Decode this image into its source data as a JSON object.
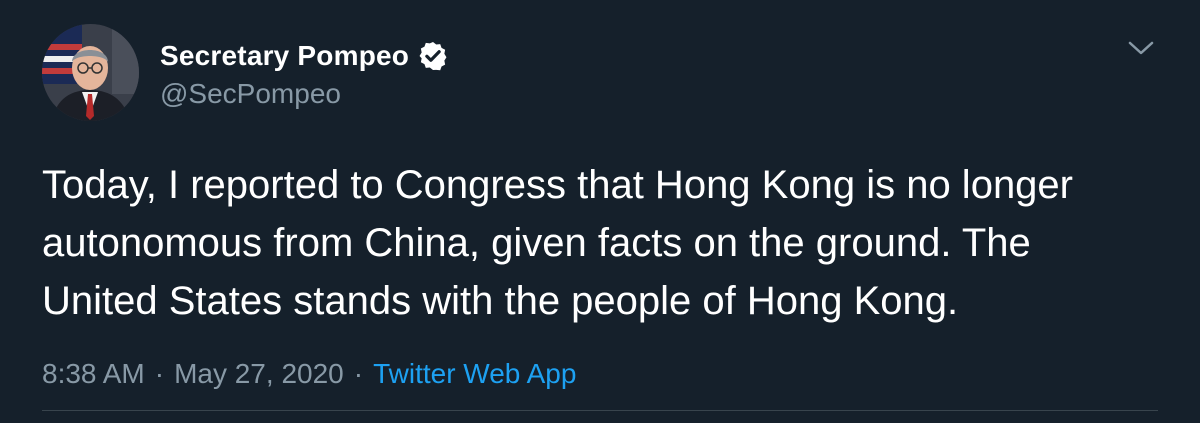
{
  "author": {
    "display_name": "Secretary Pompeo",
    "handle": "@SecPompeo",
    "verified": true
  },
  "tweet": {
    "text": "Today, I reported to Congress that Hong Kong is no longer\nautonomous from China, given facts on the ground. The\nUnited States stands with the people of Hong Kong.",
    "time": "8:38 AM",
    "separator": "·",
    "date": "May 27, 2020",
    "source": "Twitter Web App"
  },
  "icons": {
    "verified": "verified-badge-icon",
    "menu": "chevron-down-icon"
  },
  "colors": {
    "background": "#15202b",
    "primary_text": "#ffffff",
    "secondary_text": "#8899a6",
    "link": "#1da1f2"
  }
}
